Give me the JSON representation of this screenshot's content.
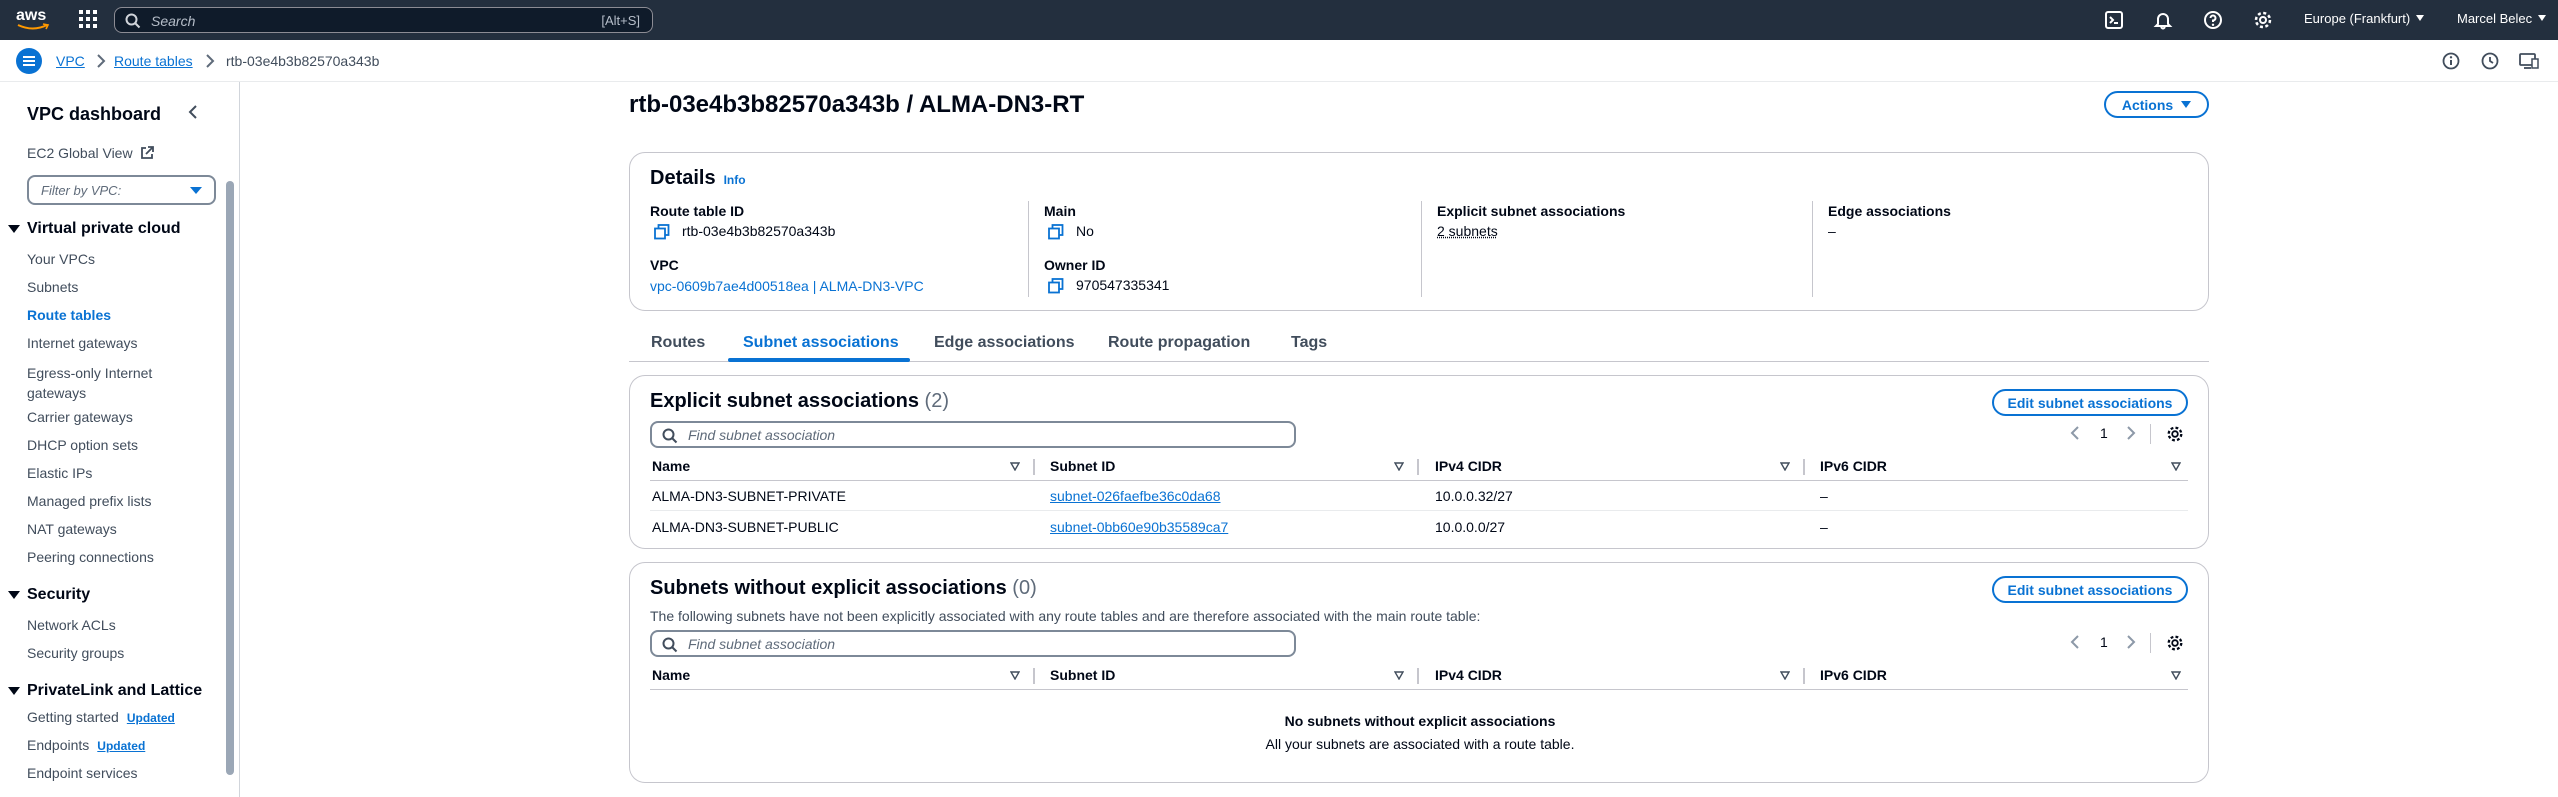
{
  "topnav": {
    "logo": "aws",
    "search_placeholder": "Search",
    "search_shortcut": "[Alt+S]",
    "region": "Europe (Frankfurt)",
    "user": "Marcel Belec"
  },
  "breadcrumb": {
    "items": [
      "VPC",
      "Route tables"
    ],
    "current": "rtb-03e4b3b82570a343b"
  },
  "sidenav": {
    "title": "VPC dashboard",
    "ec2_global_view": "EC2 Global View",
    "filter_placeholder": "Filter by VPC:",
    "sections": [
      {
        "title": "Virtual private cloud",
        "items": [
          "Your VPCs",
          "Subnets",
          "Route tables",
          "Internet gateways",
          "Egress-only Internet gateways",
          "Carrier gateways",
          "DHCP option sets",
          "Elastic IPs",
          "Managed prefix lists",
          "NAT gateways",
          "Peering connections"
        ]
      },
      {
        "title": "Security",
        "items": [
          "Network ACLs",
          "Security groups"
        ]
      },
      {
        "title": "PrivateLink and Lattice",
        "items": [
          "Getting started",
          "Endpoints",
          "Endpoint services"
        ],
        "badge": "Updated"
      }
    ]
  },
  "page": {
    "title": "rtb-03e4b3b82570a343b / ALMA-DN3-RT",
    "actions_label": "Actions"
  },
  "details": {
    "title": "Details",
    "info": "Info",
    "route_table_id_label": "Route table ID",
    "route_table_id": "rtb-03e4b3b82570a343b",
    "vpc_label": "VPC",
    "vpc": "vpc-0609b7ae4d00518ea | ALMA-DN3-VPC",
    "main_label": "Main",
    "main": "No",
    "owner_label": "Owner ID",
    "owner": "970547335341",
    "explicit_label": "Explicit subnet associations",
    "explicit": "2 subnets",
    "edge_label": "Edge associations",
    "edge": "–"
  },
  "tabs": [
    "Routes",
    "Subnet associations",
    "Edge associations",
    "Route propagation",
    "Tags"
  ],
  "explicit_table": {
    "title": "Explicit subnet associations",
    "count": "(2)",
    "edit_label": "Edit subnet associations",
    "search_placeholder": "Find subnet association",
    "page": "1",
    "columns": [
      "Name",
      "Subnet ID",
      "IPv4 CIDR",
      "IPv6 CIDR"
    ],
    "rows": [
      {
        "name": "ALMA-DN3-SUBNET-PRIVATE",
        "subnet": "subnet-026faefbe36c0da68",
        "ipv4": "10.0.0.32/27",
        "ipv6": "–"
      },
      {
        "name": "ALMA-DN3-SUBNET-PUBLIC",
        "subnet": "subnet-0bb60e90b35589ca7",
        "ipv4": "10.0.0.0/27",
        "ipv6": "–"
      }
    ]
  },
  "without_table": {
    "title": "Subnets without explicit associations",
    "count": "(0)",
    "edit_label": "Edit subnet associations",
    "description": "The following subnets have not been explicitly associated with any route tables and are therefore associated with the main route table:",
    "search_placeholder": "Find subnet association",
    "page": "1",
    "columns": [
      "Name",
      "Subnet ID",
      "IPv4 CIDR",
      "IPv6 CIDR"
    ],
    "empty_title": "No subnets without explicit associations",
    "empty_desc": "All your subnets are associated with a route table."
  },
  "colors": {
    "topnav_bg": "#232f3e",
    "link": "#0972d3",
    "text": "#000716",
    "border": "#c6c6cd"
  }
}
